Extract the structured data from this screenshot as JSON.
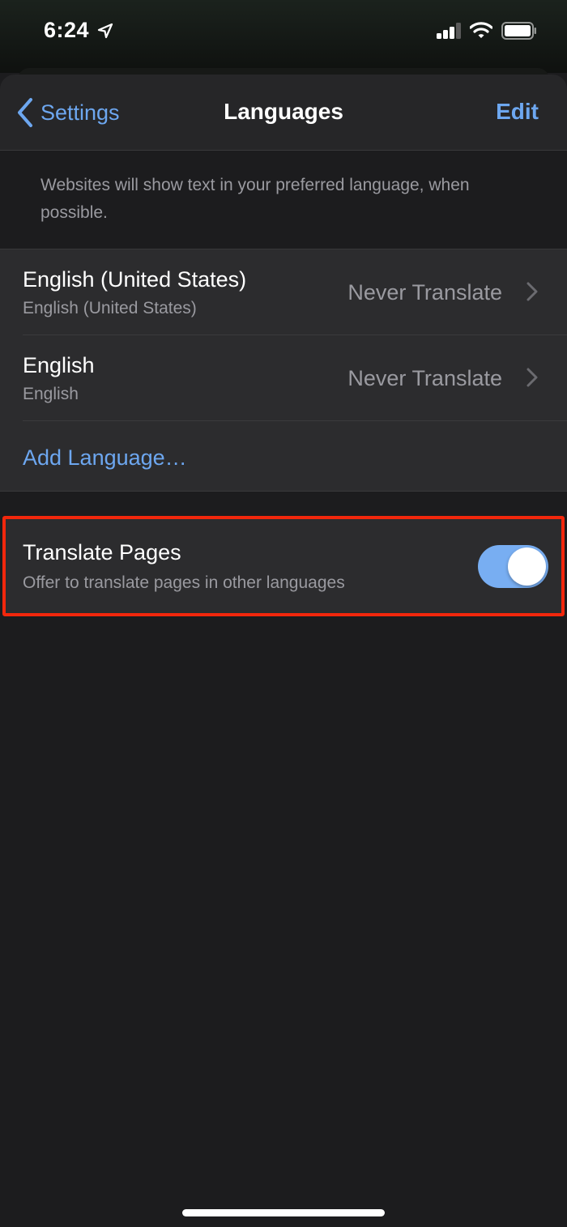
{
  "status_bar": {
    "time": "6:24",
    "icons": [
      "location-arrow-icon",
      "cellular-signal-icon",
      "wifi-icon",
      "battery-icon"
    ]
  },
  "nav": {
    "back_label": "Settings",
    "title": "Languages",
    "edit_label": "Edit"
  },
  "description": "Websites will show text in your preferred language, when possible.",
  "languages": [
    {
      "name": "English (United States)",
      "native": "English (United States)",
      "translate_setting": "Never Translate"
    },
    {
      "name": "English",
      "native": "English",
      "translate_setting": "Never Translate"
    }
  ],
  "add_language_label": "Add Language…",
  "translate_pages": {
    "title": "Translate Pages",
    "subtitle": "Offer to translate pages in other languages",
    "enabled": true
  },
  "colors": {
    "accent": "#6da7f0",
    "toggle_on": "#78aef2",
    "highlight": "#f2270c",
    "background": "#1c1c1e",
    "cell": "#2c2c2e"
  }
}
